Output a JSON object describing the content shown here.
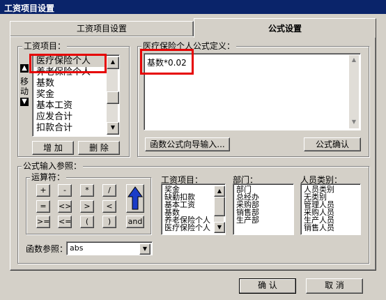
{
  "window": {
    "title": "工资项目设置"
  },
  "tabs": [
    {
      "label": "工资项目设置",
      "active": false
    },
    {
      "label": "公式设置",
      "active": true
    }
  ],
  "salary_items_panel": {
    "title": "工资项目：",
    "items": [
      "医疗保险个人",
      "养老保险个人",
      "基数",
      "奖金",
      "基本工资",
      "应发合计",
      "扣款合计"
    ],
    "selected_index": 0,
    "move_label": "移动",
    "add_label": "增 加",
    "delete_label": "删 除"
  },
  "formula_panel": {
    "title": "医疗保险个人公式定义：",
    "formula": "基数*0.02",
    "wizard_button": "函数公式向导输入...",
    "confirm_button": "公式确认"
  },
  "formula_ref": {
    "title": "公式输入参照：",
    "operators_title": "运算符：",
    "operators_row1": [
      "+",
      "-",
      "*",
      "/"
    ],
    "operators_row2": [
      "=",
      "<>",
      ">",
      "<"
    ],
    "operators_row3": [
      ">=",
      "<=",
      "(",
      ")",
      "and"
    ],
    "items_title": "工资项目：",
    "items": [
      "奖金",
      "缺勤扣款",
      "基本工资",
      "基数",
      "养老保险个人",
      "医疗保险个人"
    ],
    "dept_title": "部门：",
    "depts": [
      "部门",
      "总经办",
      "采购部",
      "销售部",
      "生产部"
    ],
    "staff_title": "人员类别：",
    "staff": [
      "人员类别",
      "无类别",
      "管理人员",
      "采购人员",
      "生产人员",
      "销售人员"
    ],
    "func_label": "函数参照：",
    "func_value": "abs"
  },
  "footer": {
    "ok": "确 认",
    "cancel": "取 消"
  },
  "colors": {
    "titlebar": "#0a246a",
    "highlight_box": "#e60000",
    "selection": "#0a246a",
    "arrow": "#1a3cc8"
  }
}
